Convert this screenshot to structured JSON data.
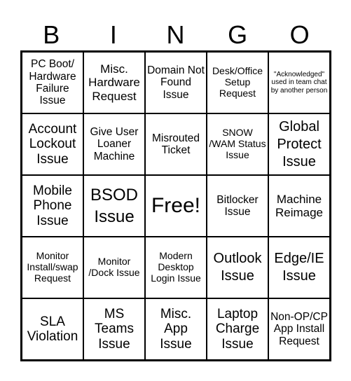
{
  "header": {
    "letters": [
      "B",
      "I",
      "N",
      "G",
      "O"
    ]
  },
  "board": {
    "rows": [
      [
        "PC Boot/ Hardware Failure Issue",
        "Misc. Hardware Request",
        "Domain Not Found Issue",
        "Desk/Office Setup Request",
        "\"Acknowledged\" used in team chat by another person"
      ],
      [
        "Account Lockout Issue",
        "Give User Loaner Machine",
        "Misrouted Ticket",
        "SNOW /WAM Status Issue",
        "Global Protect Issue"
      ],
      [
        "Mobile Phone Issue",
        "BSOD Issue",
        "Free!",
        "Bitlocker Issue",
        "Machine Reimage"
      ],
      [
        "Monitor Install/swap Request",
        "Monitor /Dock Issue",
        "Modern Desktop Login Issue",
        "Outlook Issue",
        "Edge/IE Issue"
      ],
      [
        "SLA Violation",
        "MS Teams Issue",
        "Misc. App Issue",
        "Laptop Charge Issue",
        "Non-OP/CP App Install Request"
      ]
    ],
    "free_space": "Free!"
  }
}
